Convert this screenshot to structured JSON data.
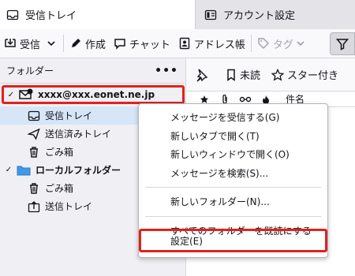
{
  "tabs": [
    {
      "label": "受信トレイ",
      "icon": "inbox-icon",
      "active": true
    },
    {
      "label": "アカウント設定",
      "icon": "account-settings-icon",
      "active": false
    }
  ],
  "toolbar": {
    "get_messages": "受信",
    "write": "作成",
    "chat": "チャット",
    "address_book": "アドレス帳",
    "tag": "タグ"
  },
  "folder_pane": {
    "title": "フォルダー",
    "more": "•••",
    "account": "xxxx@xxx.eonet.ne.jp",
    "account_folders": [
      "受信トレイ",
      "送信済みトレイ",
      "ごみ箱"
    ],
    "local_folders_label": "ローカルフォルダー",
    "local_folders": [
      "ごみ箱",
      "送信トレイ"
    ]
  },
  "quick_filter": {
    "unread": "未読",
    "starred": "スター付き"
  },
  "columns": {
    "subject": "件名"
  },
  "context_menu": {
    "items": [
      "メッセージを受信する(G)",
      "新しいタブで開く(T)",
      "新しいウィンドウで開く(O)",
      "メッセージを検索(S)..."
    ],
    "new_folder": "新しいフォルダー(N)...",
    "mark_all_read": "すべてのフォルダーを既読にする",
    "settings": "設定(E)"
  },
  "colors": {
    "highlight": "#e0221e",
    "accent": "#0060df",
    "folder": "#3f9ae8"
  }
}
